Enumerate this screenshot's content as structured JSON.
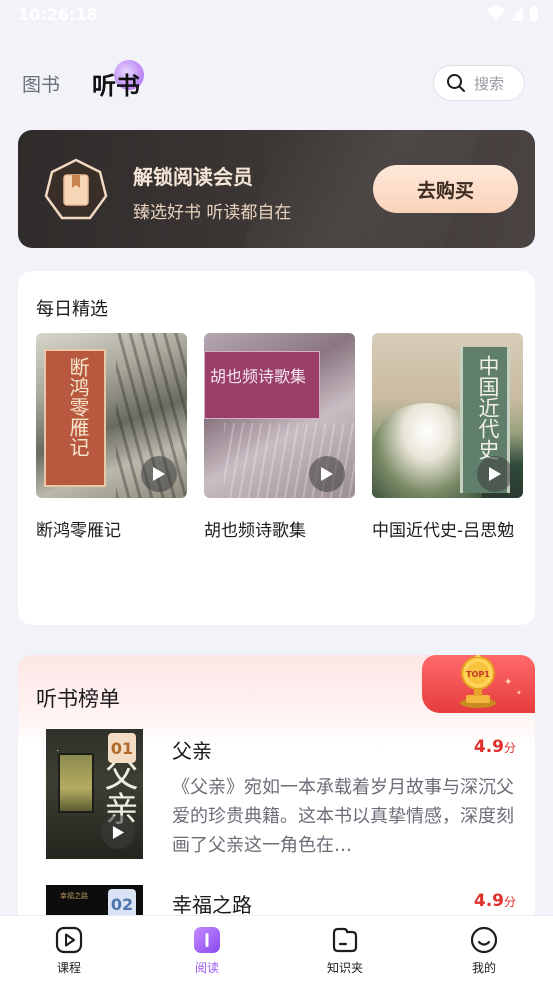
{
  "status_bar": {
    "time": "10:26:18"
  },
  "top_nav": {
    "tabs": [
      {
        "label": "图书",
        "active": false
      },
      {
        "label": "听书",
        "active": true
      }
    ],
    "search": {
      "placeholder": "搜索"
    }
  },
  "vip_banner": {
    "title": "解锁阅读会员",
    "subtitle": "臻选好书 听读都自在",
    "button": "去购买"
  },
  "daily_picks": {
    "title": "每日精选",
    "books": [
      {
        "name": "断鸿零雁记",
        "cover_text": "断鸿零雁记"
      },
      {
        "name": "胡也频诗歌集",
        "cover_text": "胡也频诗歌集"
      },
      {
        "name": "中国近代史-吕思勉",
        "cover_text": "中国近代史"
      }
    ]
  },
  "ranking": {
    "title": "听书榜单",
    "trophy_text": "TOP1",
    "items": [
      {
        "rank": "01",
        "name": "父亲",
        "score": "4.9",
        "score_unit": "分",
        "cover_text": "父亲",
        "description": "《父亲》宛如一本承载着岁月故事与深沉父爱的珍贵典籍。这本书以真挚情感，深度刻画了父亲这一角色在…"
      },
      {
        "rank": "02",
        "name": "幸福之路",
        "score": "4.9",
        "score_unit": "分",
        "cover_text": "幸福之路"
      }
    ]
  },
  "bottom_nav": {
    "items": [
      {
        "label": "课程",
        "icon": "course-icon",
        "active": false
      },
      {
        "label": "阅读",
        "icon": "read-icon",
        "active": true
      },
      {
        "label": "知识夹",
        "icon": "folder-icon",
        "active": false
      },
      {
        "label": "我的",
        "icon": "profile-icon",
        "active": false
      }
    ]
  },
  "colors": {
    "accent": "#9a55f0",
    "score": "#e0302d",
    "vip_button": "#f8d3bb"
  }
}
